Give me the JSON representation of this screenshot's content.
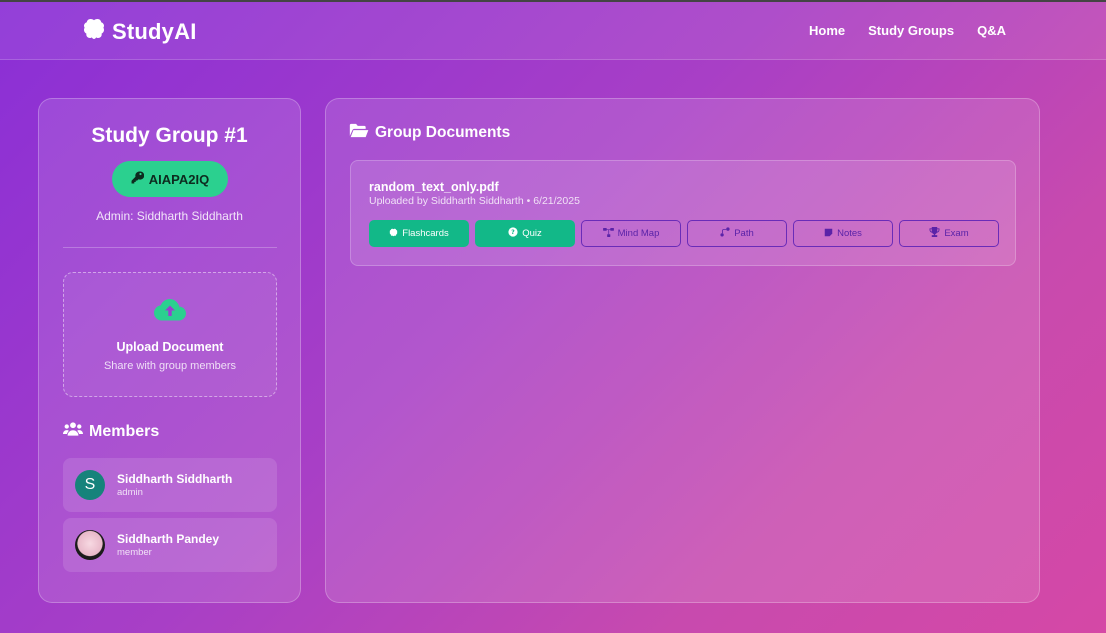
{
  "navbar": {
    "brand": "StudyAI",
    "brand_icon": "brain-icon",
    "links": [
      "Home",
      "Study Groups",
      "Q&A"
    ]
  },
  "group": {
    "title": "Study Group #1",
    "code": "AIAPA2IQ",
    "code_icon": "key-icon",
    "admin": "Admin: Siddharth Siddharth"
  },
  "upload": {
    "icon": "cloud-upload-icon",
    "title": "Upload Document",
    "subtitle": "Share with group members"
  },
  "members": {
    "title": "Members",
    "icon": "users-icon",
    "list": [
      {
        "name": "Siddharth Siddharth",
        "role": "admin",
        "initial": "S"
      },
      {
        "name": "Siddharth Pandey",
        "role": "member"
      }
    ]
  },
  "documents": {
    "title": "Group Documents",
    "icon": "folder-open-icon",
    "items": [
      {
        "name": "random_text_only.pdf",
        "meta": "Uploaded by Siddharth Siddharth • 6/21/2025",
        "actions": [
          "Flashcards",
          "Quiz",
          "Mind Map",
          "Path",
          "Notes",
          "Exam"
        ]
      }
    ]
  },
  "colors": {
    "accent_green": "#2bd08f",
    "action_green": "#12b888",
    "outline_purple": "#6a2cb8"
  }
}
